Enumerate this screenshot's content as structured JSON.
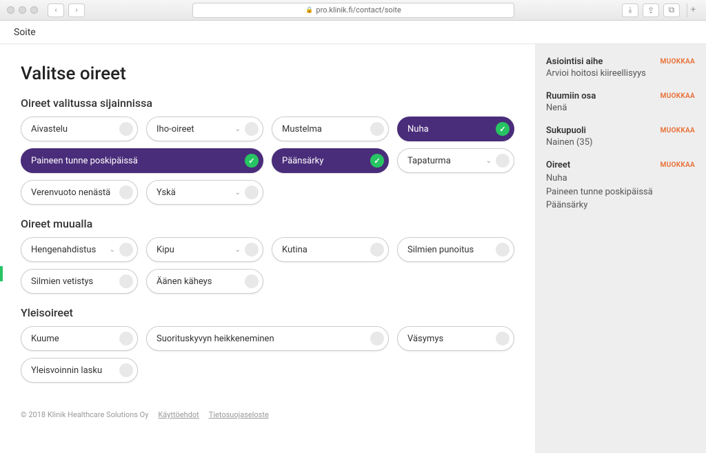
{
  "browser": {
    "url": "pro.klinik.fi/contact/soite"
  },
  "header": {
    "title": "Soite"
  },
  "main": {
    "title": "Valitse oireet",
    "section1": {
      "heading": "Oireet valitussa sijainnissa",
      "items": [
        {
          "label": "Aivastelu",
          "dropdown": false,
          "selected": false
        },
        {
          "label": "Iho-oireet",
          "dropdown": true,
          "selected": false
        },
        {
          "label": "Mustelma",
          "dropdown": false,
          "selected": false
        },
        {
          "label": "Nuha",
          "dropdown": false,
          "selected": true
        },
        {
          "label": "Paineen tunne poskipäissä",
          "dropdown": false,
          "selected": true,
          "double": true
        },
        {
          "label": "Päänsärky",
          "dropdown": false,
          "selected": true
        },
        {
          "label": "Tapaturma",
          "dropdown": true,
          "selected": false
        },
        {
          "label": "Verenvuoto nenästä",
          "dropdown": false,
          "selected": false
        },
        {
          "label": "Yskä",
          "dropdown": true,
          "selected": false
        }
      ]
    },
    "section2": {
      "heading": "Oireet muualla",
      "items": [
        {
          "label": "Hengenahdistus",
          "dropdown": true,
          "selected": false
        },
        {
          "label": "Kipu",
          "dropdown": true,
          "selected": false
        },
        {
          "label": "Kutina",
          "dropdown": false,
          "selected": false
        },
        {
          "label": "Silmien punoitus",
          "dropdown": false,
          "selected": false
        },
        {
          "label": "Silmien vetistys",
          "dropdown": false,
          "selected": false
        },
        {
          "label": "Äänen käheys",
          "dropdown": false,
          "selected": false
        }
      ]
    },
    "section3": {
      "heading": "Yleisoireet",
      "items": [
        {
          "label": "Kuume",
          "dropdown": false,
          "selected": false
        },
        {
          "label": "Suorituskyvyn heikkeneminen",
          "dropdown": false,
          "selected": false,
          "wide": true
        },
        {
          "label": "Väsymys",
          "dropdown": false,
          "selected": false
        },
        {
          "label": "Yleisvoinnin lasku",
          "dropdown": false,
          "selected": false
        }
      ]
    }
  },
  "footer": {
    "copyright": "© 2018 Klinik Healthcare Solutions Oy",
    "link1": "Käyttöehdot",
    "link2": "Tietosuojaseloste"
  },
  "sidebar": {
    "edit_label": "MUOKKAA",
    "groups": [
      {
        "title": "Asiointisi aihe",
        "sub": "Arvioi hoitosi kiireellisyys"
      },
      {
        "title": "Ruumiin osa",
        "sub": "Nenä"
      },
      {
        "title": "Sukupuoli",
        "sub": "Nainen (35)"
      },
      {
        "title": "Oireet",
        "list": [
          "Nuha",
          "Paineen tunne poskipäissä",
          "Päänsärky"
        ]
      }
    ]
  }
}
